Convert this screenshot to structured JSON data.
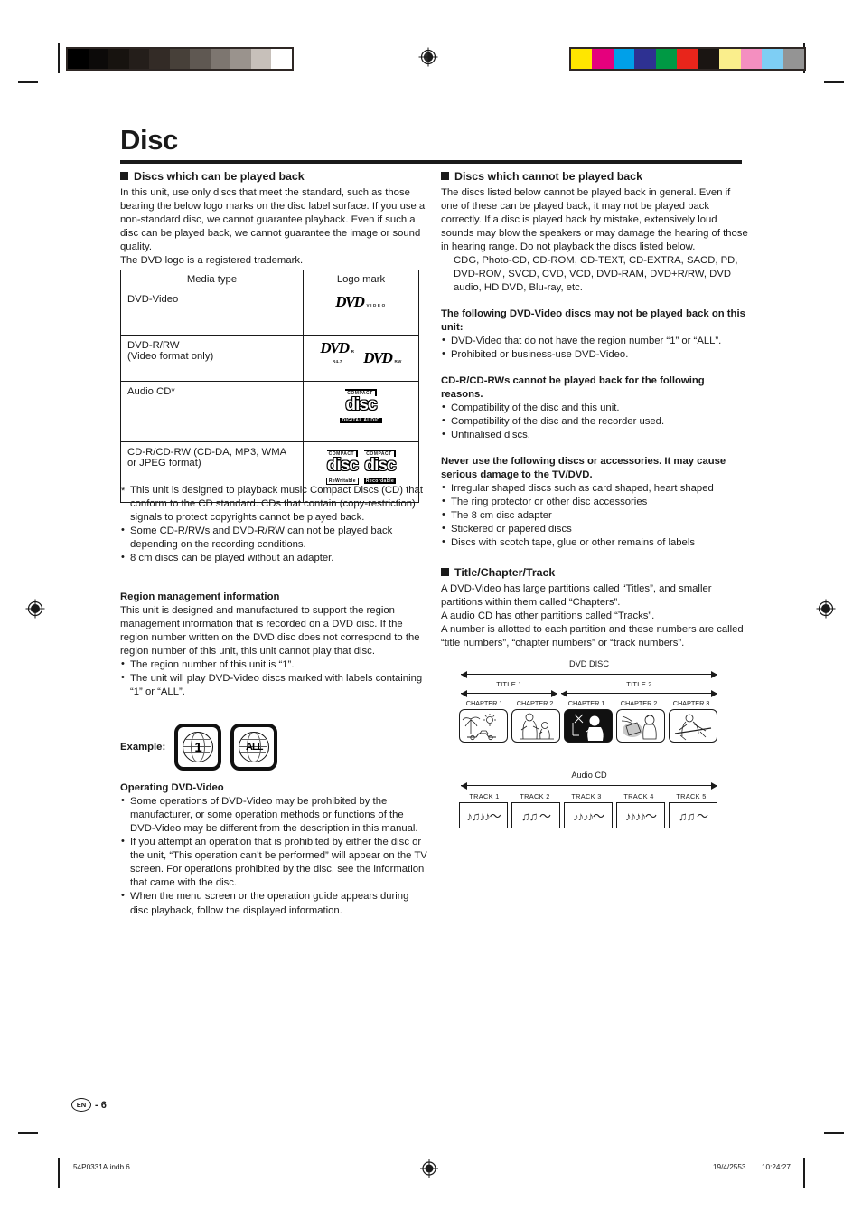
{
  "page": {
    "title": "Disc",
    "page_label": "EN",
    "page_number": "- 6"
  },
  "footer": {
    "file": "54P0331A.indb  6",
    "date": "19/4/2553",
    "time": "10:24:27"
  },
  "colorbars": {
    "gray_steps": [
      "#000000",
      "#0c0a09",
      "#17130f",
      "#241e1a",
      "#332b26",
      "#474039",
      "#5f5852",
      "#7d7670",
      "#9a938d",
      "#c7c0ba",
      "#ffffff"
    ],
    "color_swatches": [
      "#ffe600",
      "#e5007d",
      "#00a0e9",
      "#2e3192",
      "#009944",
      "#e8251b",
      "#1a1512",
      "#faee8c",
      "#f48fc0",
      "#7ecef4",
      "#949494"
    ]
  },
  "left_column": {
    "section1": {
      "heading": "Discs which can be played back",
      "body": "In this unit, use only discs that meet the standard, such as those bearing the below logo marks on the disc label surface. If you use a non-standard disc, we cannot guarantee playback. Even if such a disc can be played back, we cannot guarantee the image or sound quality.\nThe DVD logo is a registered trademark."
    },
    "table": {
      "headers": [
        "Media type",
        "Logo mark"
      ],
      "rows": [
        {
          "media": "DVD-Video",
          "logo": "dvd-video-logo"
        },
        {
          "media": "DVD-R/RW\n(Video format only)",
          "logo": "dvd-r-rw-logo"
        },
        {
          "media": "Audio CD*",
          "logo": "compact-disc-digital-audio-logo"
        },
        {
          "media": "CD-R/CD-RW (CD-DA, MP3, WMA or JPEG format)",
          "logo": "compact-disc-rewritable-recordable-logo"
        }
      ]
    },
    "footnotes": [
      "This unit is designed to playback music Compact Discs (CD) that conform to the CD standard. CDs that contain (copy-restriction) signals to protect copyrights cannot be played back.",
      "Some CD-R/RWs and DVD-R/RW can not be played back depending on the recording conditions.",
      "8 cm discs can be played without an adapter."
    ],
    "region": {
      "heading": "Region management information",
      "body": "This unit is designed and manufactured to support the region management information that is recorded on a DVD disc. If the region number written on the DVD disc does not correspond to the region number of this unit, this unit cannot play that disc.",
      "bullets": [
        "The region number of this unit is “1”.",
        "The unit will play DVD-Video discs marked with labels containing “1” or “ALL”."
      ],
      "example_label": "Example:",
      "example_icons": [
        "1",
        "ALL"
      ]
    },
    "operating": {
      "heading": "Operating DVD-Video",
      "bullets": [
        "Some operations of DVD-Video may be prohibited by the manufacturer, or some operation methods or functions of the DVD-Video may be different from the description in this manual.",
        "If you attempt an operation that is prohibited by either the disc or the unit, “This operation can’t be performed” will appear on the TV screen. For operations prohibited by the disc, see the information that came with the disc.",
        "When the menu screen or the operation guide appears during disc playback, follow the displayed information."
      ]
    }
  },
  "right_column": {
    "section2": {
      "heading": "Discs which cannot be played back",
      "body": "The discs listed below cannot be played back in general. Even if one of these can be played back, it may not be played back correctly. If a disc is played back by mistake, extensively loud sounds may blow the speakers or may damage the hearing of those in hearing range. Do not playback the discs listed below.",
      "list": "CDG, Photo-CD, CD-ROM, CD-TEXT, CD-EXTRA, SACD, PD, DVD-ROM, SVCD, CVD, VCD, DVD-RAM, DVD+R/RW, DVD audio, HD DVD, Blu-ray, etc."
    },
    "not_played": {
      "heading": "The following DVD-Video discs may not be played back on this unit:",
      "bullets": [
        "DVD-Video that do not have the region number “1” or “ALL”.",
        "Prohibited or business-use DVD-Video."
      ]
    },
    "cdr_reasons": {
      "heading": "CD-R/CD-RWs cannot be played back for the following reasons.",
      "bullets": [
        "Compatibility of the disc and this unit.",
        "Compatibility of the disc and the recorder used.",
        "Unfinalised discs."
      ]
    },
    "never_use": {
      "heading": "Never use the following discs or accessories. It may cause serious damage to the TV/DVD.",
      "bullets": [
        "Irregular shaped discs such as card shaped, heart shaped",
        "The ring protector or other disc accessories",
        "The 8 cm disc adapter",
        "Stickered or papered discs",
        "Discs with scotch tape, glue or other remains of labels"
      ]
    },
    "title_chapter_track": {
      "heading": "Title/Chapter/Track",
      "body": "A DVD-Video has large partitions called “Titles”, and smaller partitions within them called “Chapters”.\nA audio CD has other partitions called “Tracks”.\nA number is allotted to each partition and these numbers are called “title numbers”, “chapter numbers” or “track numbers”."
    },
    "dvd_diagram": {
      "caption": "DVD DISC",
      "titles": [
        "TITLE 1",
        "TITLE 2"
      ],
      "chapters": [
        "CHAPTER 1",
        "CHAPTER 2",
        "CHAPTER 1",
        "CHAPTER 2",
        "CHAPTER 3"
      ]
    },
    "cd_diagram": {
      "caption": "Audio CD",
      "tracks": [
        "TRACK  1",
        "TRACK  2",
        "TRACK  3",
        "TRACK  4",
        "TRACK  5"
      ],
      "notes": [
        "♪♫♪♪～",
        "♫♫ ～",
        "♪♪♪♪～",
        "♪♪♪♪～",
        "♫♫ ～"
      ]
    }
  }
}
